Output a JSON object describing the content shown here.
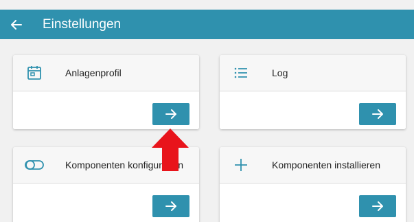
{
  "header": {
    "title": "Einstellungen",
    "back_icon": "arrow-left-icon",
    "background": "#2f91ae"
  },
  "cards": [
    {
      "label": "Anlagenprofil",
      "icon": "calendar-icon",
      "button_icon": "arrow-right-icon"
    },
    {
      "label": "Log",
      "icon": "list-icon",
      "button_icon": "arrow-right-icon"
    },
    {
      "label": "Komponenten konfigurieren",
      "icon": "toggle-icon",
      "button_icon": "arrow-right-icon"
    },
    {
      "label": "Komponenten installieren",
      "icon": "plus-icon",
      "button_icon": "arrow-right-icon"
    }
  ],
  "annotation": {
    "icon": "red-up-arrow-icon",
    "color": "#e8141b"
  },
  "colors": {
    "accent": "#2f91ae",
    "background": "#f1f1f1"
  }
}
